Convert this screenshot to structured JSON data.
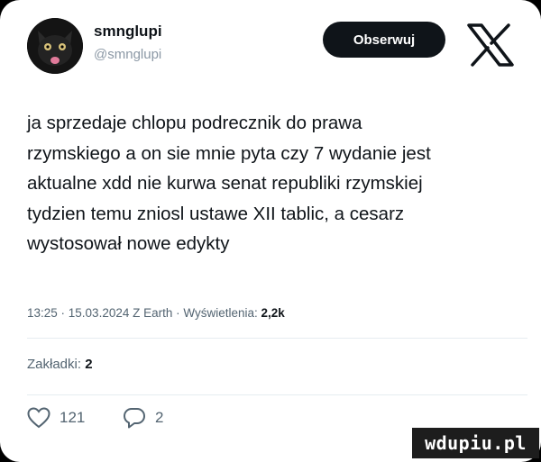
{
  "header": {
    "display_name": "smnglupi",
    "handle": "@smnglupi",
    "follow_label": "Obserwuj"
  },
  "tweet": {
    "text": "ja sprzedaje chlopu podrecznik do prawa\nrzymskiego a on sie mnie pyta czy 7 wydanie jest\naktualne xdd nie kurwa senat republiki rzymskiej\ntydzien temu zniosl ustawe XII tablic, a cesarz\nwystosował nowe edykty",
    "meta_prefix": "13:25 · 15.03.2024 Z Earth · Wyświetlenia: ",
    "views": "2,2k"
  },
  "stats": {
    "bookmarks_label": "Zakładki: ",
    "bookmarks_count": "2"
  },
  "actions": {
    "likes": "121",
    "replies": "2"
  },
  "watermark": "wdupiu.pl",
  "colors": {
    "text": "#0f1419",
    "muted": "#536471",
    "follow_bg": "#0f1419"
  }
}
